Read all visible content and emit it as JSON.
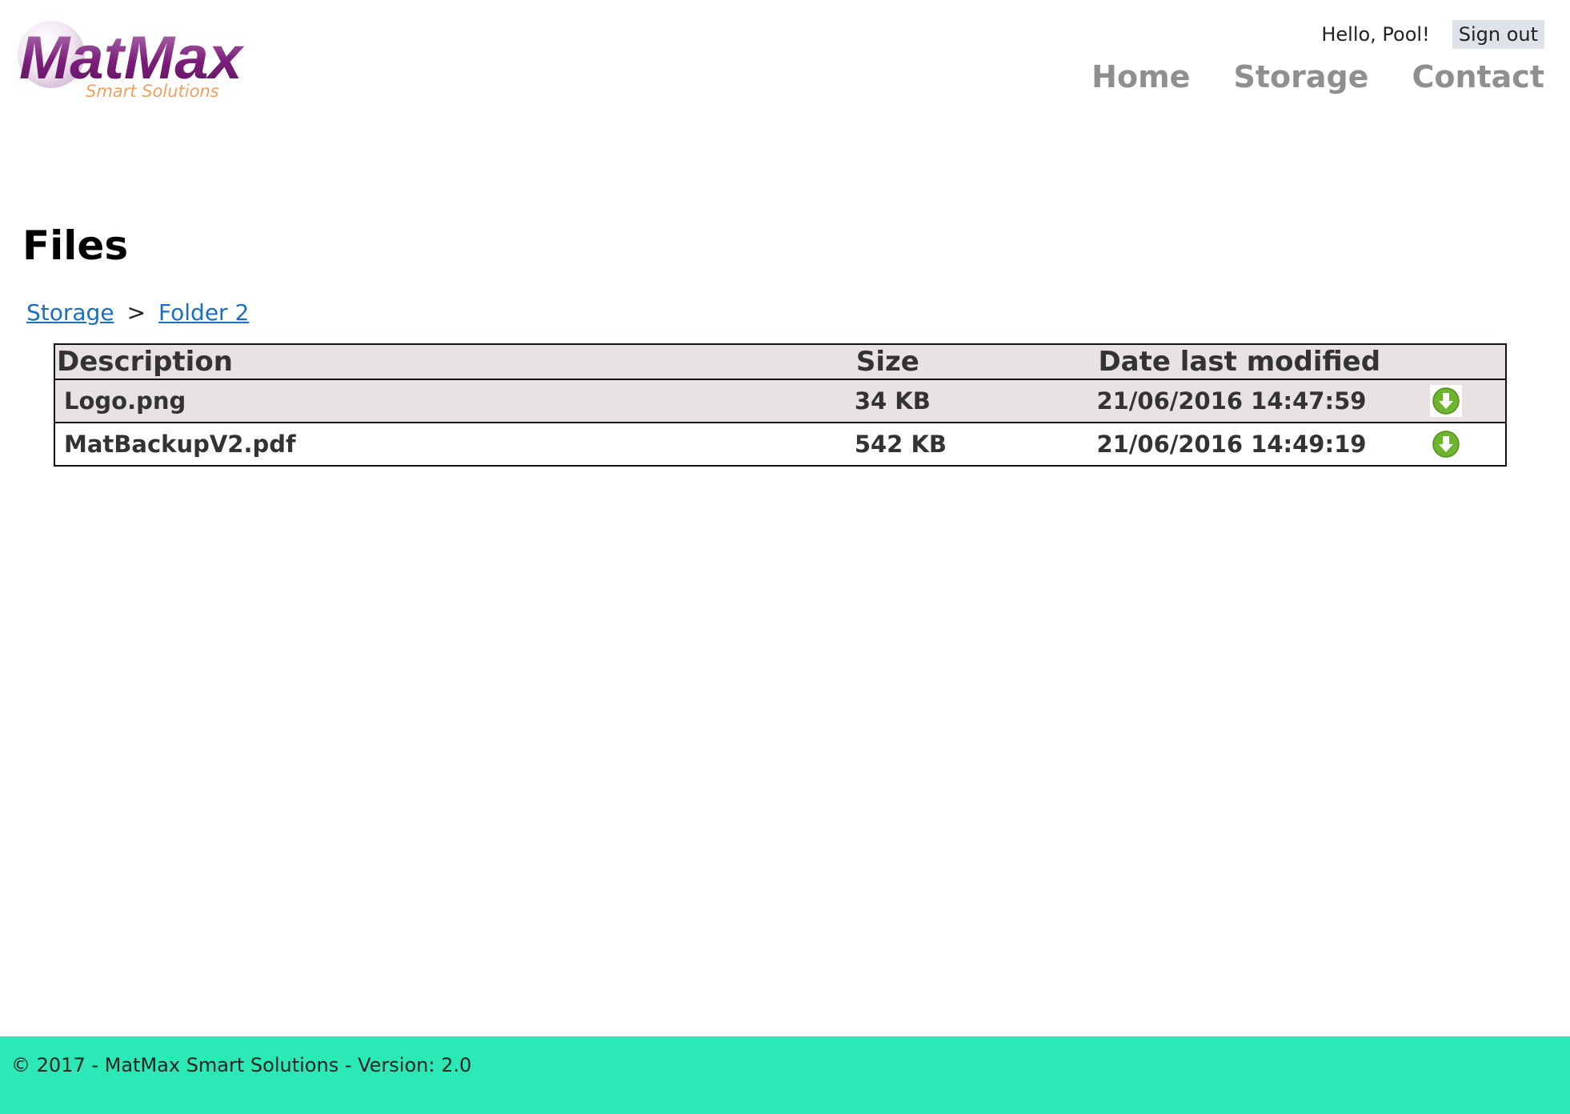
{
  "logo": {
    "brand": "MatMax",
    "tagline": "Smart Solutions"
  },
  "header": {
    "greeting": "Hello, Pool!",
    "signout_label": "Sign out",
    "nav": [
      "Home",
      "Storage",
      "Contact"
    ]
  },
  "page": {
    "title": "Files",
    "breadcrumb": [
      "Storage",
      "Folder 2"
    ],
    "breadcrumb_separator": ">"
  },
  "table": {
    "columns": [
      "Description",
      "Size",
      "Date last modified"
    ],
    "rows": [
      {
        "description": "Logo.png",
        "size": "34 KB",
        "modified": "21/06/2016 14:47:59",
        "action_icon": "download-icon"
      },
      {
        "description": "MatBackupV2.pdf",
        "size": "542 KB",
        "modified": "21/06/2016 14:49:19",
        "action_icon": "download-icon"
      }
    ]
  },
  "footer": {
    "text": "© 2017 - MatMax Smart Solutions - Version: 2.0"
  },
  "colors": {
    "footer_bg": "#2be8b6",
    "link": "#1a6fc4",
    "nav": "#8f8f8f",
    "row_alt_bg": "#e8e2e2",
    "logo_purple": "#7b1e7b",
    "logo_orange": "#f0a060",
    "download_green": "#6cb52d"
  }
}
